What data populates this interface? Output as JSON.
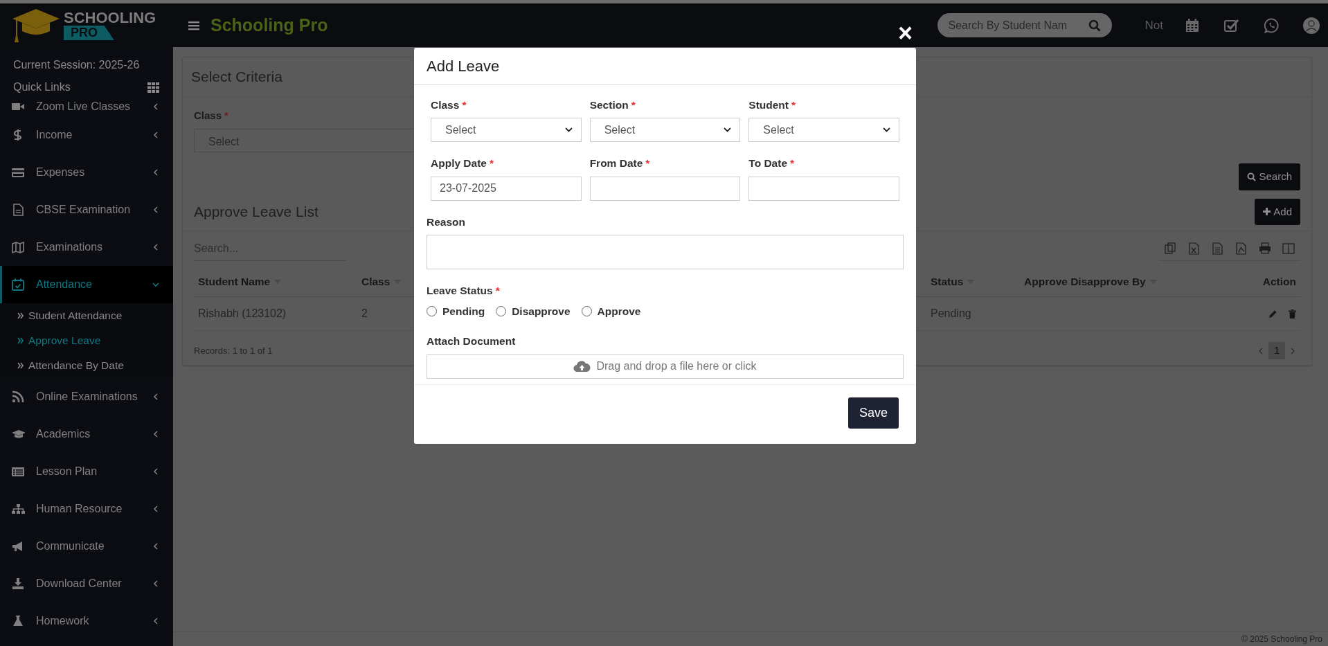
{
  "header": {
    "logo_top": "SCHOOLING",
    "logo_bottom": "PRO",
    "title": "Schooling Pro",
    "search": {
      "placeholder": "Search By Student Nam"
    },
    "notice": "Not"
  },
  "sidebar": {
    "session": "Current Session: 2025-26",
    "quick_links": "Quick Links",
    "items": [
      {
        "label": "Zoom Live Classes",
        "expanded": false,
        "selected": false
      },
      {
        "label": "Income",
        "expanded": false,
        "selected": false
      },
      {
        "label": "Expenses",
        "expanded": false,
        "selected": false
      },
      {
        "label": "CBSE Examination",
        "expanded": false,
        "selected": false
      },
      {
        "label": "Examinations",
        "expanded": false,
        "selected": false
      },
      {
        "label": "Attendance",
        "expanded": true,
        "selected": true,
        "children": [
          {
            "label": "Student Attendance",
            "selected": false
          },
          {
            "label": "Approve Leave",
            "selected": true
          },
          {
            "label": "Attendance By Date",
            "selected": false
          }
        ]
      },
      {
        "label": "Online Examinations",
        "expanded": false,
        "selected": false
      },
      {
        "label": "Academics",
        "expanded": false,
        "selected": false
      },
      {
        "label": "Lesson Plan",
        "expanded": false,
        "selected": false
      },
      {
        "label": "Human Resource",
        "expanded": false,
        "selected": false
      },
      {
        "label": "Communicate",
        "expanded": false,
        "selected": false
      },
      {
        "label": "Download Center",
        "expanded": false,
        "selected": false
      },
      {
        "label": "Homework",
        "expanded": false,
        "selected": false
      }
    ]
  },
  "criteria": {
    "title": "Select Criteria",
    "class_label": "Class",
    "required_mark": "*",
    "class_select": "Select",
    "search_button": "Search"
  },
  "leave_list": {
    "title": "Approve Leave List",
    "add_button": "Add",
    "search": {
      "placeholder": "Search..."
    },
    "columns": [
      {
        "label": "Student Name",
        "sortable": true
      },
      {
        "label": "Class",
        "sortable": true
      },
      {
        "label": "Status",
        "sortable": true
      },
      {
        "label": "Approve Disapprove By",
        "sortable": true
      },
      {
        "label": "Action",
        "sortable": false
      }
    ],
    "rows": [
      {
        "cells": [
          "Rishabh (123102)",
          "2",
          "Pending"
        ]
      }
    ],
    "records": "Records: 1 to 1 of 1",
    "pages": [
      {
        "label": "1",
        "selected": true
      }
    ]
  },
  "modal": {
    "title": "Add Leave",
    "close": "×",
    "fields": [
      {
        "kind": "select",
        "label": "Class",
        "required_mark": "*",
        "value": "Select"
      },
      {
        "kind": "select",
        "label": "Section",
        "required_mark": "*",
        "value": "Select"
      },
      {
        "kind": "select",
        "label": "Student",
        "required_mark": "*",
        "value": "Select"
      },
      {
        "kind": "input",
        "label": "Apply Date",
        "required_mark": "*",
        "value": "23-07-2025"
      },
      {
        "kind": "input",
        "label": "From Date",
        "required_mark": "*"
      },
      {
        "kind": "input",
        "label": "To Date",
        "required_mark": "*"
      }
    ],
    "reason": {
      "label": "Reason"
    },
    "leave_status": {
      "label": "Leave Status",
      "required_mark": "*",
      "options": [
        {
          "label": "Pending",
          "selected": false
        },
        {
          "label": "Disapprove",
          "selected": false
        },
        {
          "label": "Approve",
          "selected": false
        }
      ]
    },
    "attach": {
      "label": "Attach Document",
      "text": "Drag and drop a file here or click"
    },
    "save_button": "Save"
  },
  "footer": "© 2025 Schooling Pro"
}
